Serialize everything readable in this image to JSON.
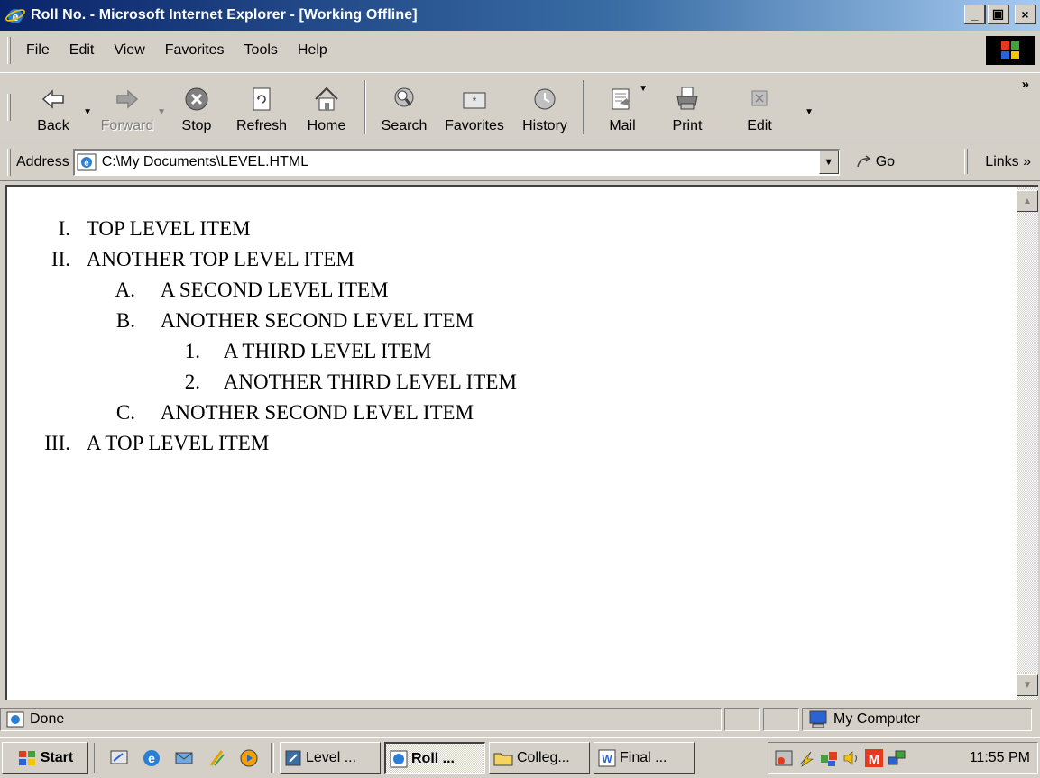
{
  "window": {
    "title": "Roll No. - Microsoft Internet Explorer - [Working Offline]",
    "caption_buttons": [
      "_",
      "▣",
      "×"
    ]
  },
  "menu": [
    "File",
    "Edit",
    "View",
    "Favorites",
    "Tools",
    "Help"
  ],
  "toolbar": {
    "back": "Back",
    "forward": "Forward",
    "stop": "Stop",
    "refresh": "Refresh",
    "home": "Home",
    "search": "Search",
    "favorites": "Favorites",
    "history": "History",
    "mail": "Mail",
    "print": "Print",
    "edit": "Edit",
    "more": "»"
  },
  "address": {
    "label": "Address",
    "value": "C:\\My Documents\\LEVEL.HTML",
    "go": "Go",
    "links": "Links »"
  },
  "outline": [
    {
      "marker": "I.",
      "text": "TOP LEVEL ITEM",
      "level": 1
    },
    {
      "marker": "II.",
      "text": "ANOTHER TOP LEVEL ITEM",
      "level": 1
    },
    {
      "marker": "A.",
      "text": "A SECOND LEVEL ITEM",
      "level": 2
    },
    {
      "marker": "B.",
      "text": "ANOTHER SECOND LEVEL ITEM",
      "level": 2
    },
    {
      "marker": "1.",
      "text": "A THIRD LEVEL ITEM",
      "level": 3
    },
    {
      "marker": "2.",
      "text": "ANOTHER THIRD LEVEL ITEM",
      "level": 3
    },
    {
      "marker": "C.",
      "text": "ANOTHER SECOND LEVEL ITEM",
      "level": 2
    },
    {
      "marker": "III.",
      "text": "A TOP LEVEL ITEM",
      "level": 1
    }
  ],
  "status": {
    "text": "Done",
    "zone": "My Computer"
  },
  "taskbar": {
    "start": "Start",
    "tasks": [
      {
        "label": "Level ...",
        "active": false
      },
      {
        "label": "Roll ...",
        "active": true
      },
      {
        "label": "Colleg...",
        "active": false
      },
      {
        "label": "Final ...",
        "active": false
      }
    ],
    "clock": "11:55 PM"
  }
}
